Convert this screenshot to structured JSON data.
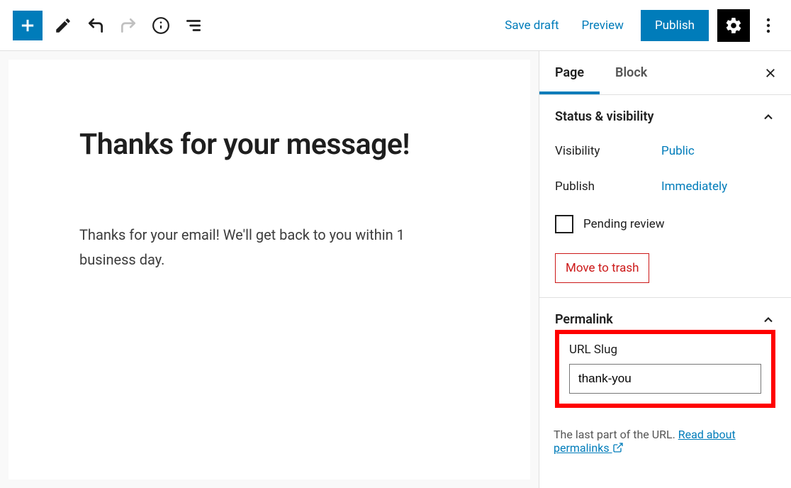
{
  "toolbar": {
    "save_draft": "Save draft",
    "preview": "Preview",
    "publish": "Publish"
  },
  "sidebar": {
    "tabs": {
      "page": "Page",
      "block": "Block"
    },
    "status": {
      "title": "Status & visibility",
      "visibility_label": "Visibility",
      "visibility_value": "Public",
      "publish_label": "Publish",
      "publish_value": "Immediately",
      "pending_review": "Pending review",
      "trash": "Move to trash"
    },
    "permalink": {
      "title": "Permalink",
      "slug_label": "URL Slug",
      "slug_value": "thank-you",
      "helper_prefix": "The last part of the URL. ",
      "helper_link": "Read about permalinks"
    }
  },
  "content": {
    "title": "Thanks for your message!",
    "body": "Thanks for your email! We'll get back to you within 1 business day."
  }
}
